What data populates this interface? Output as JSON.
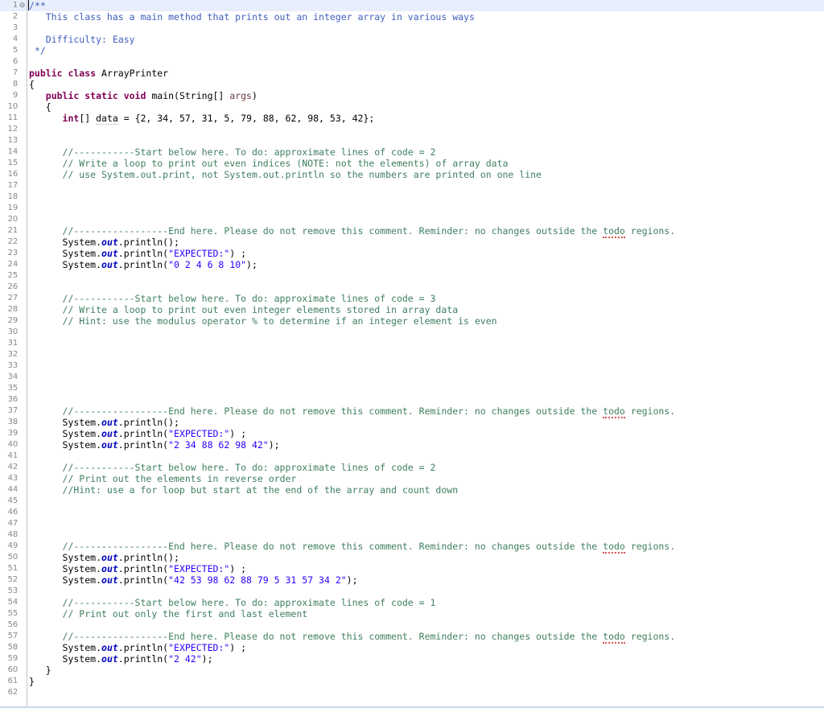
{
  "editor": {
    "file_name": "ArrayPrinter.java",
    "language": "Java",
    "theme": "eclipse-light",
    "first_visible_line": 1,
    "last_visible_line": 62,
    "current_line": 1,
    "caret_line": 1,
    "caret_column": 1,
    "colors": {
      "background": "#ffffff",
      "current_line_highlight": "#e8eefb",
      "gutter_text": "#888888",
      "gutter_divider": "#c7c7c7",
      "keyword": "#7f0055",
      "javadoc_comment": "#3f5fbf",
      "line_comment": "#3f7f5f",
      "string": "#2a00ff",
      "static_field": "#0000c0",
      "parameter": "#6a3e3e",
      "spellcheck_underline": "#d9534f",
      "plain_text": "#000000"
    },
    "fold_markers": [
      {
        "line": 1,
        "glyph": "⊖",
        "state": "expanded"
      }
    ]
  },
  "gutter": {
    "line_numbers": [
      1,
      2,
      3,
      4,
      5,
      6,
      7,
      8,
      9,
      10,
      11,
      12,
      13,
      14,
      15,
      16,
      17,
      18,
      19,
      20,
      21,
      22,
      23,
      24,
      25,
      26,
      27,
      28,
      29,
      30,
      31,
      32,
      33,
      34,
      35,
      36,
      37,
      38,
      39,
      40,
      41,
      42,
      43,
      44,
      45,
      46,
      47,
      48,
      49,
      50,
      51,
      52,
      53,
      54,
      55,
      56,
      57,
      58,
      59,
      60,
      61,
      62
    ]
  },
  "code": {
    "lines": [
      {
        "n": 1,
        "tokens": [
          {
            "t": "jdoc",
            "s": "/**"
          }
        ]
      },
      {
        "n": 2,
        "tokens": [
          {
            "t": "jdoc",
            "s": "   This class has a main method that prints out an integer array in various ways"
          }
        ]
      },
      {
        "n": 3,
        "tokens": []
      },
      {
        "n": 4,
        "tokens": [
          {
            "t": "jdoc",
            "s": "   Difficulty: Easy"
          }
        ]
      },
      {
        "n": 5,
        "tokens": [
          {
            "t": "jdoc",
            "s": " */"
          }
        ]
      },
      {
        "n": 6,
        "tokens": []
      },
      {
        "n": 7,
        "tokens": [
          {
            "t": "kw",
            "s": "public class "
          },
          {
            "t": "plain",
            "s": "ArrayPrinter"
          }
        ]
      },
      {
        "n": 8,
        "tokens": [
          {
            "t": "plain",
            "s": "{"
          }
        ]
      },
      {
        "n": 9,
        "tokens": [
          {
            "t": "plain",
            "s": "   "
          },
          {
            "t": "kw",
            "s": "public static void "
          },
          {
            "t": "plain",
            "s": "main(String[] "
          },
          {
            "t": "param",
            "s": "args"
          },
          {
            "t": "plain",
            "s": ")"
          }
        ]
      },
      {
        "n": 10,
        "tokens": [
          {
            "t": "plain",
            "s": "   {"
          }
        ]
      },
      {
        "n": 11,
        "tokens": [
          {
            "t": "plain",
            "s": "      "
          },
          {
            "t": "kw",
            "s": "int"
          },
          {
            "t": "plain",
            "s": "[] "
          },
          {
            "t": "localdecl",
            "s": "data"
          },
          {
            "t": "plain",
            "s": " = {2, 34, 57, 31, 5, 79, 88, 62, 98, 53, 42};"
          }
        ]
      },
      {
        "n": 12,
        "tokens": []
      },
      {
        "n": 13,
        "tokens": []
      },
      {
        "n": 14,
        "tokens": [
          {
            "t": "cmt",
            "s": "      //-----------Start below here. To do: approximate lines of code = 2"
          }
        ]
      },
      {
        "n": 15,
        "tokens": [
          {
            "t": "cmt",
            "s": "      // Write a loop to print out even indices (NOTE: not the elements) of array data"
          }
        ]
      },
      {
        "n": 16,
        "tokens": [
          {
            "t": "cmt",
            "s": "      // use System.out.print, not System.out.println so the numbers are printed on one line"
          }
        ]
      },
      {
        "n": 17,
        "tokens": []
      },
      {
        "n": 18,
        "tokens": []
      },
      {
        "n": 19,
        "tokens": []
      },
      {
        "n": 20,
        "tokens": []
      },
      {
        "n": 21,
        "tokens": [
          {
            "t": "cmt",
            "s": "      //-----------------End here. Please do not remove this comment. Reminder: no changes outside the "
          },
          {
            "t": "spell",
            "s": "todo"
          },
          {
            "t": "cmt",
            "s": " regions."
          }
        ]
      },
      {
        "n": 22,
        "tokens": [
          {
            "t": "plain",
            "s": "      System."
          },
          {
            "t": "fld",
            "s": "out"
          },
          {
            "t": "plain",
            "s": ".println();"
          }
        ]
      },
      {
        "n": 23,
        "tokens": [
          {
            "t": "plain",
            "s": "      System."
          },
          {
            "t": "fld",
            "s": "out"
          },
          {
            "t": "plain",
            "s": ".println("
          },
          {
            "t": "str",
            "s": "\"EXPECTED:\""
          },
          {
            "t": "plain",
            "s": ") ;"
          }
        ]
      },
      {
        "n": 24,
        "tokens": [
          {
            "t": "plain",
            "s": "      System."
          },
          {
            "t": "fld",
            "s": "out"
          },
          {
            "t": "plain",
            "s": ".println("
          },
          {
            "t": "str",
            "s": "\"0 2 4 6 8 10\""
          },
          {
            "t": "plain",
            "s": ");"
          }
        ]
      },
      {
        "n": 25,
        "tokens": []
      },
      {
        "n": 26,
        "tokens": []
      },
      {
        "n": 27,
        "tokens": [
          {
            "t": "cmt",
            "s": "      //-----------Start below here. To do: approximate lines of code = 3"
          }
        ]
      },
      {
        "n": 28,
        "tokens": [
          {
            "t": "cmt",
            "s": "      // Write a loop to print out even integer elements stored in array data"
          }
        ]
      },
      {
        "n": 29,
        "tokens": [
          {
            "t": "cmt",
            "s": "      // Hint: use the modulus operator % to determine if an integer element is even"
          }
        ]
      },
      {
        "n": 30,
        "tokens": []
      },
      {
        "n": 31,
        "tokens": []
      },
      {
        "n": 32,
        "tokens": []
      },
      {
        "n": 33,
        "tokens": []
      },
      {
        "n": 34,
        "tokens": []
      },
      {
        "n": 35,
        "tokens": []
      },
      {
        "n": 36,
        "tokens": []
      },
      {
        "n": 37,
        "tokens": [
          {
            "t": "cmt",
            "s": "      //-----------------End here. Please do not remove this comment. Reminder: no changes outside the "
          },
          {
            "t": "spell",
            "s": "todo"
          },
          {
            "t": "cmt",
            "s": " regions."
          }
        ]
      },
      {
        "n": 38,
        "tokens": [
          {
            "t": "plain",
            "s": "      System."
          },
          {
            "t": "fld",
            "s": "out"
          },
          {
            "t": "plain",
            "s": ".println();"
          }
        ]
      },
      {
        "n": 39,
        "tokens": [
          {
            "t": "plain",
            "s": "      System."
          },
          {
            "t": "fld",
            "s": "out"
          },
          {
            "t": "plain",
            "s": ".println("
          },
          {
            "t": "str",
            "s": "\"EXPECTED:\""
          },
          {
            "t": "plain",
            "s": ") ;"
          }
        ]
      },
      {
        "n": 40,
        "tokens": [
          {
            "t": "plain",
            "s": "      System."
          },
          {
            "t": "fld",
            "s": "out"
          },
          {
            "t": "plain",
            "s": ".println("
          },
          {
            "t": "str",
            "s": "\"2 34 88 62 98 42\""
          },
          {
            "t": "plain",
            "s": ");"
          }
        ]
      },
      {
        "n": 41,
        "tokens": []
      },
      {
        "n": 42,
        "tokens": [
          {
            "t": "cmt",
            "s": "      //-----------Start below here. To do: approximate lines of code = 2"
          }
        ]
      },
      {
        "n": 43,
        "tokens": [
          {
            "t": "cmt",
            "s": "      // Print out the elements in reverse order"
          }
        ]
      },
      {
        "n": 44,
        "tokens": [
          {
            "t": "cmt",
            "s": "      //Hint: use a for loop but start at the end of the array and count down"
          }
        ]
      },
      {
        "n": 45,
        "tokens": []
      },
      {
        "n": 46,
        "tokens": []
      },
      {
        "n": 47,
        "tokens": []
      },
      {
        "n": 48,
        "tokens": []
      },
      {
        "n": 49,
        "tokens": [
          {
            "t": "cmt",
            "s": "      //-----------------End here. Please do not remove this comment. Reminder: no changes outside the "
          },
          {
            "t": "spell",
            "s": "todo"
          },
          {
            "t": "cmt",
            "s": " regions."
          }
        ]
      },
      {
        "n": 50,
        "tokens": [
          {
            "t": "plain",
            "s": "      System."
          },
          {
            "t": "fld",
            "s": "out"
          },
          {
            "t": "plain",
            "s": ".println();"
          }
        ]
      },
      {
        "n": 51,
        "tokens": [
          {
            "t": "plain",
            "s": "      System."
          },
          {
            "t": "fld",
            "s": "out"
          },
          {
            "t": "plain",
            "s": ".println("
          },
          {
            "t": "str",
            "s": "\"EXPECTED:\""
          },
          {
            "t": "plain",
            "s": ") ;"
          }
        ]
      },
      {
        "n": 52,
        "tokens": [
          {
            "t": "plain",
            "s": "      System."
          },
          {
            "t": "fld",
            "s": "out"
          },
          {
            "t": "plain",
            "s": ".println("
          },
          {
            "t": "str",
            "s": "\"42 53 98 62 88 79 5 31 57 34 2\""
          },
          {
            "t": "plain",
            "s": ");"
          }
        ]
      },
      {
        "n": 53,
        "tokens": []
      },
      {
        "n": 54,
        "tokens": [
          {
            "t": "cmt",
            "s": "      //-----------Start below here. To do: approximate lines of code = 1"
          }
        ]
      },
      {
        "n": 55,
        "tokens": [
          {
            "t": "cmt",
            "s": "      // Print out only the first and last element"
          }
        ]
      },
      {
        "n": 56,
        "tokens": []
      },
      {
        "n": 57,
        "tokens": [
          {
            "t": "cmt",
            "s": "      //-----------------End here. Please do not remove this comment. Reminder: no changes outside the "
          },
          {
            "t": "spell",
            "s": "todo"
          },
          {
            "t": "cmt",
            "s": " regions."
          }
        ]
      },
      {
        "n": 58,
        "tokens": [
          {
            "t": "plain",
            "s": "      System."
          },
          {
            "t": "fld",
            "s": "out"
          },
          {
            "t": "plain",
            "s": ".println("
          },
          {
            "t": "str",
            "s": "\"EXPECTED:\""
          },
          {
            "t": "plain",
            "s": ") ;"
          }
        ]
      },
      {
        "n": 59,
        "tokens": [
          {
            "t": "plain",
            "s": "      System."
          },
          {
            "t": "fld",
            "s": "out"
          },
          {
            "t": "plain",
            "s": ".println("
          },
          {
            "t": "str",
            "s": "\"2 42\""
          },
          {
            "t": "plain",
            "s": ");"
          }
        ]
      },
      {
        "n": 60,
        "tokens": [
          {
            "t": "plain",
            "s": "   }"
          }
        ]
      },
      {
        "n": 61,
        "tokens": [
          {
            "t": "plain",
            "s": "}"
          }
        ]
      },
      {
        "n": 62,
        "tokens": []
      }
    ]
  }
}
